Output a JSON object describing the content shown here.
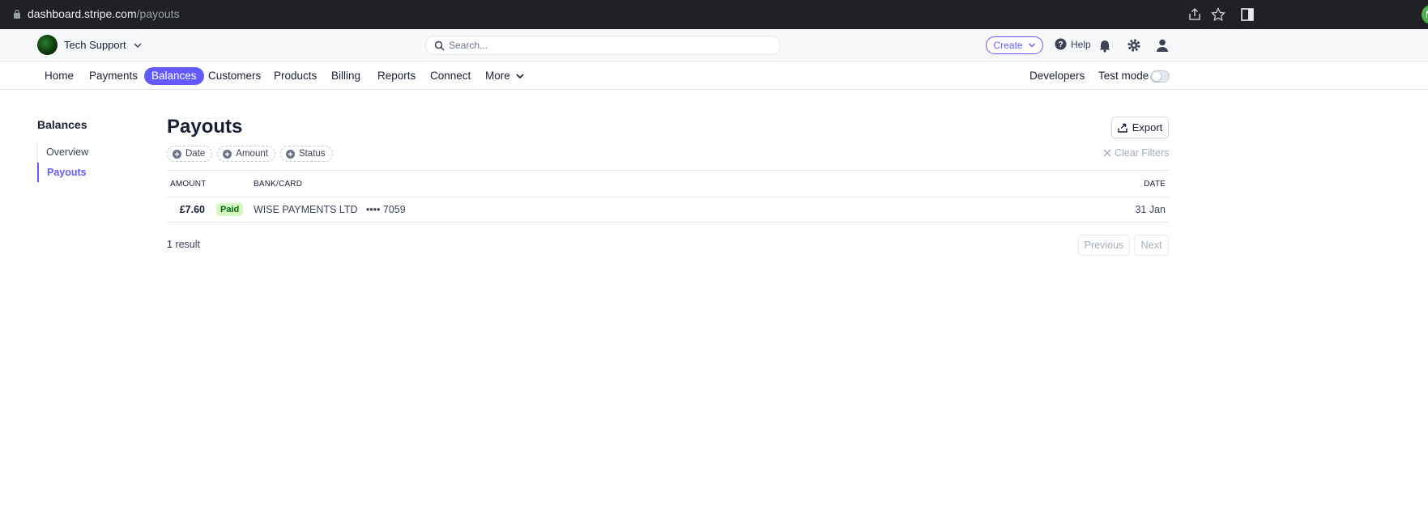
{
  "browser": {
    "url_host": "dashboard.stripe.com",
    "url_path": "/payouts",
    "profile_initial": "M"
  },
  "topbar": {
    "account_name": "Tech Support",
    "search_placeholder": "Search...",
    "create_label": "Create",
    "help_label": "Help"
  },
  "nav": {
    "items": [
      "Home",
      "Payments",
      "Balances",
      "Customers",
      "Products",
      "Billing",
      "Reports",
      "Connect",
      "More"
    ],
    "active": "Balances",
    "developers_label": "Developers",
    "test_mode_label": "Test mode",
    "test_mode_on": false
  },
  "sidebar": {
    "title": "Balances",
    "items": [
      "Overview",
      "Payouts"
    ],
    "active": "Payouts"
  },
  "main": {
    "title": "Payouts",
    "export_label": "Export",
    "filters": [
      "Date",
      "Amount",
      "Status"
    ],
    "clear_filters_label": "Clear Filters",
    "columns": {
      "amount": "AMOUNT",
      "bank": "BANK/CARD",
      "date": "DATE"
    },
    "rows": [
      {
        "amount": "£7.60",
        "status": "Paid",
        "bank": "WISE PAYMENTS LTD",
        "last4": "•••• 7059",
        "date": "31 Jan"
      }
    ],
    "result_count": "1",
    "result_label": "result",
    "previous_label": "Previous",
    "next_label": "Next"
  },
  "colors": {
    "accent": "#635bff",
    "paid_badge_bg": "#d7f7c2",
    "paid_badge_text": "#05690d",
    "chrome_bg": "#202124"
  }
}
